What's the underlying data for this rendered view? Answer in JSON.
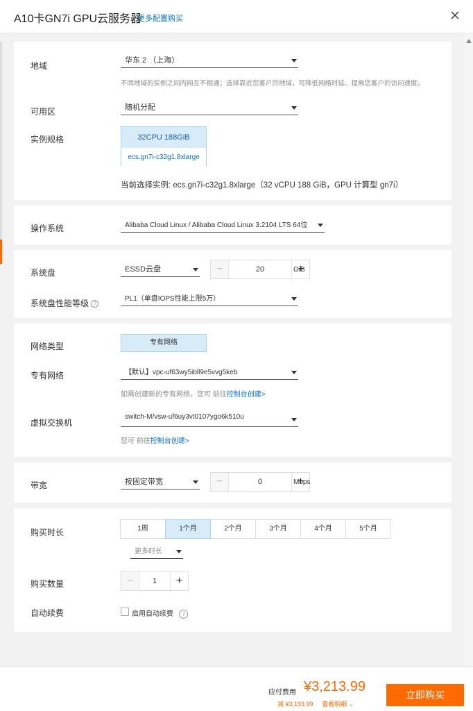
{
  "header": {
    "title": "A10卡GN7i GPU云服务器",
    "more_link": "更多配置购买"
  },
  "region": {
    "label": "地域",
    "value": "华东 2 （上海）",
    "hint": "不同地域的实例之间内网互不相通；选择靠近您客户的地域，可降低网络时延、提高您客户的访问速度。"
  },
  "zone": {
    "label": "可用区",
    "value": "随机分配"
  },
  "spec": {
    "label": "实例规格",
    "cpu_mem": "32CPU 188GiB",
    "type_name": "ecs.gn7i-c32g1.8xlarge",
    "current": "当前选择实例: ecs.gn7i-c32g1.8xlarge（32 vCPU 188 GiB，GPU 计算型 gn7i）"
  },
  "os": {
    "label": "操作系统",
    "value": "Alibaba Cloud Linux / Alibaba Cloud Linux 3.2104 LTS 64位"
  },
  "disk": {
    "label": "系统盘",
    "type": "ESSD云盘",
    "size": "20",
    "unit": "GiB",
    "perf_label": "系统盘性能等级",
    "perf_value": "PL1（单盘IOPS性能上限5万）"
  },
  "network": {
    "type_label": "网络类型",
    "type_value": "专有网络",
    "vpc_label": "专有网络",
    "vpc_value": "【默认】vpc-uf63wy5ibll9e5vvg5keb",
    "vpc_hint": "如需创建新的专有网络，您可 前往",
    "vpc_hint_link": "控制台创建>",
    "vswitch_label": "虚拟交换机",
    "vswitch_value": "switch-M/vsw-uf6uy3vt0107ygo6k510u",
    "vswitch_hint": "您可 前往",
    "vswitch_hint_link": "控制台创建>"
  },
  "bandwidth": {
    "label": "带宽",
    "mode": "按固定带宽",
    "value": "0",
    "unit": "Mbps"
  },
  "purchase": {
    "duration_label": "购买时长",
    "durations": [
      "1周",
      "1个月",
      "2个月",
      "3个月",
      "4个月",
      "5个月"
    ],
    "selected": "1个月",
    "more_duration": "更多时长",
    "quantity_label": "购买数量",
    "quantity": "1",
    "autorenew_label": "自动续费",
    "autorenew_option": "启用自动续费"
  },
  "footer": {
    "fee_label": "应付费用",
    "price": "¥3,213.99",
    "discount": "减 ¥3,193.99",
    "detail_link": "查看明细",
    "buy_button": "立即购买"
  },
  "colors": {
    "accent": "#ff6a00",
    "link": "#0070cc",
    "selected_bg": "#d7ebf8"
  }
}
